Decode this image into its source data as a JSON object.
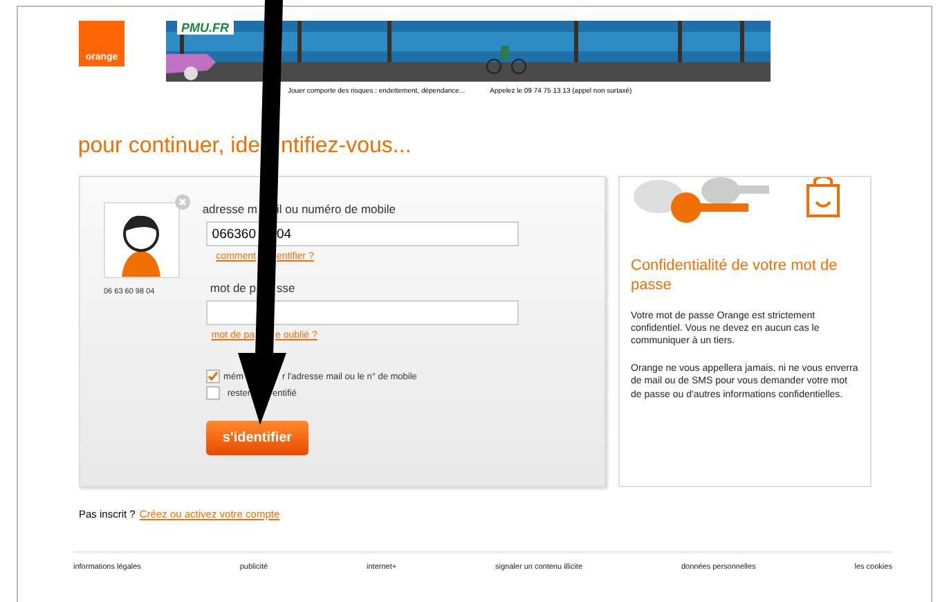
{
  "logo": {
    "text": "orange"
  },
  "banner": {
    "kind": "picture",
    "brand": "PMU.FR",
    "warning": "Jouer comporte des risques : endettement, dépendance...",
    "helpline": "Appelez le 09 74 75 13 13 (appel non surtaxé)"
  },
  "heading": [
    "pour continuer, ide",
    "ntifiez-vous..."
  ],
  "login": {
    "account_number": "06 63 60 98 04",
    "login_label": [
      "adresse m",
      "il ou numéro de mobile"
    ],
    "login_value": [
      "066360",
      "04"
    ],
    "login_help": [
      "comment",
      "entifier ?"
    ],
    "password_label": [
      "mot de p",
      "sse"
    ],
    "password_help": [
      "mot de pa",
      "e oublié ?"
    ],
    "options": [
      {
        "label": [
          "mém",
          "r l'adresse mail ou le n° de mobile"
        ],
        "checked": true
      },
      {
        "label": [
          "rester",
          "entifié"
        ],
        "checked": false
      }
    ],
    "submit": "s'identifier"
  },
  "privacy": {
    "title": "Confidentialité de votre mot de passe",
    "paragraphs": [
      "Votre mot de passe Orange est strictement confidentiel. Vous ne devez en aucun cas le communiquer à un tiers.",
      "Orange ne vous appellera jamais, ni ne vous enverra de mail ou de SMS pour vous demander votre mot de passe ou d'autres informations confidentielles."
    ]
  },
  "signup": {
    "text": "Pas inscrit ?",
    "link": "Créez ou activez votre compte"
  },
  "footer": [
    "informations légales",
    "publicité",
    "internet+",
    "signaler un contenu illicite",
    "données personnelles",
    "les cookies"
  ]
}
